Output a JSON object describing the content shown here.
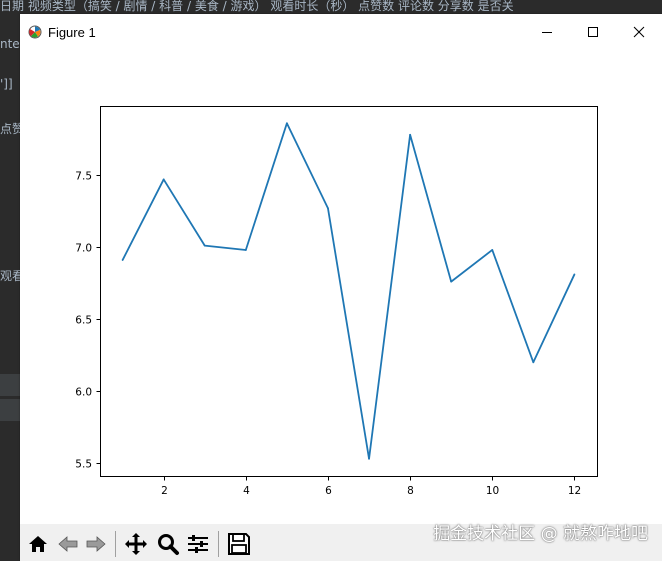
{
  "background": {
    "top_text": "日期  视频类型（搞笑 / 剧情 / 科普 / 美食 / 游戏）  观看时长（秒）  点赞数  评论数  分享数  是否关",
    "left_fragments": [
      "nte",
      "']]",
      "点赞数",
      "观看时"
    ]
  },
  "window": {
    "title": "Figure 1",
    "icon": "matplotlib-logo-icon",
    "controls": [
      "minimize-icon",
      "maximize-icon",
      "close-icon"
    ]
  },
  "toolbar": {
    "buttons": [
      {
        "name": "home-button",
        "icon": "home-icon"
      },
      {
        "name": "back-button",
        "icon": "arrow-left-icon"
      },
      {
        "name": "forward-button",
        "icon": "arrow-right-icon"
      },
      {
        "name": "pan-button",
        "icon": "move-icon"
      },
      {
        "name": "zoom-button",
        "icon": "magnifier-icon"
      },
      {
        "name": "configure-subplots-button",
        "icon": "sliders-icon"
      },
      {
        "name": "save-button",
        "icon": "floppy-disk-icon"
      }
    ]
  },
  "watermark": "掘金技术社区 @ 就熬咋地吧",
  "colors": {
    "line": "#1f77b4",
    "window_bg": "#ffffff",
    "toolbar_bg": "#f0f0f0",
    "desktop_bg": "#2b2b2b"
  },
  "chart_data": {
    "type": "line",
    "x": [
      1,
      2,
      3,
      4,
      5,
      6,
      7,
      8,
      9,
      10,
      11,
      12
    ],
    "series": [
      {
        "values": [
          6.91,
          7.47,
          7.01,
          6.98,
          7.86,
          7.27,
          5.53,
          7.78,
          6.76,
          6.98,
          6.2,
          6.81
        ]
      }
    ],
    "xticks": [
      "2",
      "4",
      "6",
      "8",
      "10",
      "12"
    ],
    "yticks": [
      "5.5",
      "6.0",
      "6.5",
      "7.0",
      "7.5"
    ],
    "xlim": [
      0.45,
      12.55
    ],
    "ylim": [
      5.41,
      7.98
    ],
    "title": "",
    "xlabel": "",
    "ylabel": "",
    "grid": false
  }
}
